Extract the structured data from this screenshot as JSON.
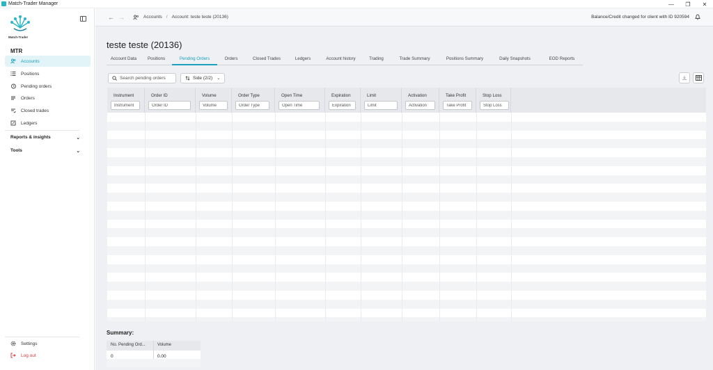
{
  "window": {
    "title": "Match-Trader Manager",
    "controls": [
      "—",
      "❐",
      "✕"
    ]
  },
  "sidebar": {
    "logo_text": "Match-Trader",
    "brand": "MTR",
    "items": [
      {
        "label": "Accounts",
        "icon": "users-icon",
        "active": true
      },
      {
        "label": "Positions",
        "icon": "list-icon"
      },
      {
        "label": "Pending orders",
        "icon": "pending-icon"
      },
      {
        "label": "Orders",
        "icon": "orders-icon"
      },
      {
        "label": "Closed trades",
        "icon": "closed-trades-icon"
      },
      {
        "label": "Ledgers",
        "icon": "ledger-icon"
      }
    ],
    "groups": [
      {
        "label": "Reports & insights"
      },
      {
        "label": "Tools"
      }
    ],
    "bottom": [
      {
        "label": "Settings",
        "icon": "gear-icon"
      },
      {
        "label": "Log out",
        "icon": "logout-icon"
      }
    ]
  },
  "topbar": {
    "crumb_root": "Accounts",
    "crumb_sep": "/",
    "crumb_current": "Account: teste teste (20136)",
    "notice": "Balance/Credit changed for client with ID 920594"
  },
  "page": {
    "title": "teste teste (20136)"
  },
  "tabs": [
    {
      "label": "Account Data"
    },
    {
      "label": "Positions"
    },
    {
      "label": "Pending Orders",
      "active": true
    },
    {
      "label": "Orders"
    },
    {
      "label": "Closed Trades"
    },
    {
      "label": "Ledgers"
    },
    {
      "label": "Account history"
    },
    {
      "label": "Trading"
    },
    {
      "label": "Trade Summary"
    },
    {
      "label": "Positions Summary"
    },
    {
      "label": "Daily Snapshots"
    },
    {
      "label": "EOD Reports"
    }
  ],
  "toolbar": {
    "search_placeholder": "Search pending orders",
    "side_filter": "Side (2/2)"
  },
  "table": {
    "columns": [
      {
        "label": "Instrument",
        "filter": "Instrument"
      },
      {
        "label": "Order ID",
        "filter": "Order ID"
      },
      {
        "label": "Volume",
        "filter": "Volume"
      },
      {
        "label": "Order Type",
        "filter": "Order Type"
      },
      {
        "label": "Open Time",
        "filter": "Open Time"
      },
      {
        "label": "Expiration",
        "filter": "Expiration"
      },
      {
        "label": "Limit",
        "filter": "Limit"
      },
      {
        "label": "Activation",
        "filter": "Activation"
      },
      {
        "label": "Take Profit",
        "filter": "Take Profit"
      },
      {
        "label": "Stop Loss",
        "filter": "Stop Loss"
      }
    ],
    "rows": []
  },
  "summary": {
    "title": "Summary:",
    "headers": [
      "No. Pending Ord...",
      "Volume"
    ],
    "values": [
      "0",
      "0.00"
    ]
  },
  "colors": {
    "accent": "#1a9fbd",
    "active_bg": "#e3f4f8",
    "logout": "#d93535"
  }
}
